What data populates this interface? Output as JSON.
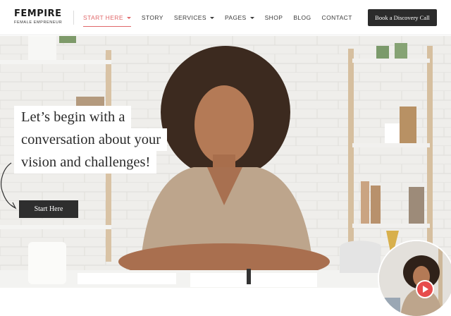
{
  "brand": {
    "name": "FEMPIRE",
    "tagline": "FEMALE EMPRENEUR"
  },
  "nav": {
    "items": [
      {
        "label": "START HERE",
        "has_dropdown": true,
        "active": true
      },
      {
        "label": "STORY",
        "has_dropdown": false,
        "active": false
      },
      {
        "label": "SERVICES",
        "has_dropdown": true,
        "active": false
      },
      {
        "label": "PAGES",
        "has_dropdown": true,
        "active": false
      },
      {
        "label": "SHOP",
        "has_dropdown": false,
        "active": false
      },
      {
        "label": "BLOG",
        "has_dropdown": false,
        "active": false
      },
      {
        "label": "CONTACT",
        "has_dropdown": false,
        "active": false
      }
    ],
    "cta_label": "Book a Discovery Call"
  },
  "hero": {
    "headline_lines": [
      "Let’s begin with a",
      "conversation about your",
      "vision and challenges!"
    ],
    "button_label": "Start Here"
  },
  "colors": {
    "accent": "#e0686a",
    "dark": "#2b2b2b",
    "play": "#e74c4c"
  },
  "icons": {
    "video_play": "play-icon",
    "dropdown": "chevron-down-icon"
  }
}
